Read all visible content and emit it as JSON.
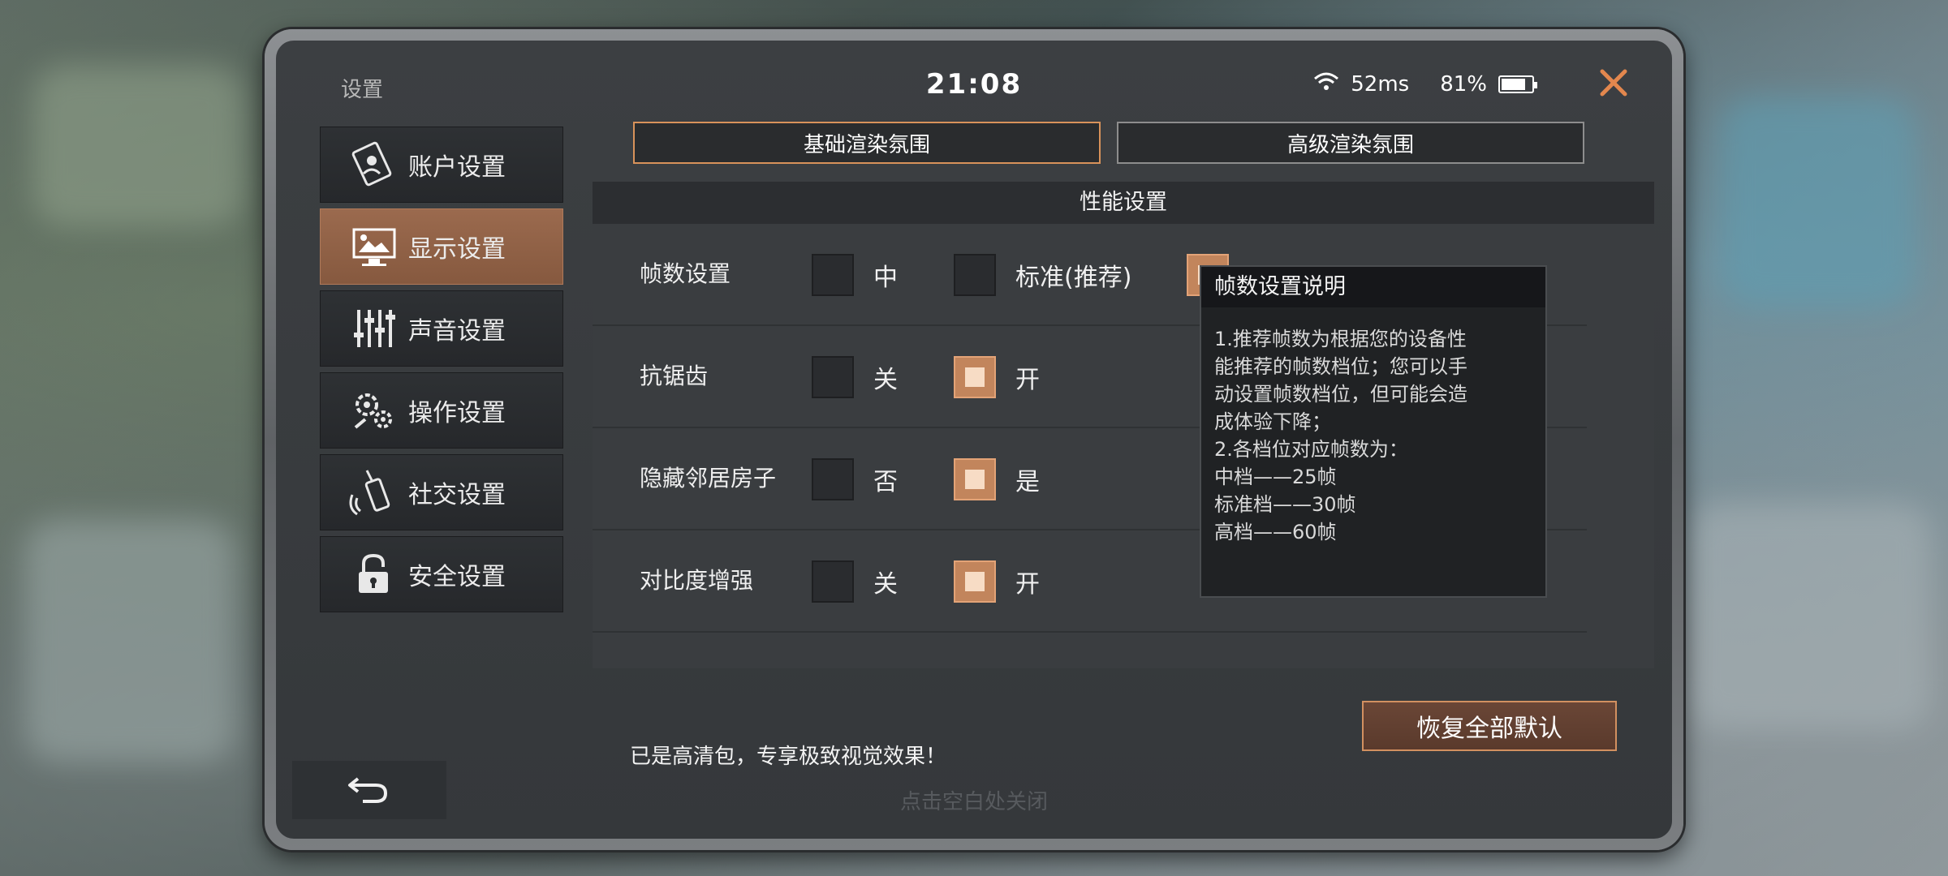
{
  "status": {
    "title": "设置",
    "time": "21:08",
    "ping": "52ms",
    "battery": "81%",
    "battery_level": 0.81
  },
  "sidebar": {
    "items": [
      {
        "label": "账户设置",
        "icon": "account-card-icon"
      },
      {
        "label": "显示设置",
        "icon": "monitor-image-icon"
      },
      {
        "label": "声音设置",
        "icon": "sliders-icon"
      },
      {
        "label": "操作设置",
        "icon": "gears-icon"
      },
      {
        "label": "社交设置",
        "icon": "walkie-talkie-icon"
      },
      {
        "label": "安全设置",
        "icon": "padlock-icon"
      }
    ],
    "active_index": 1
  },
  "tabs": {
    "basic": "基础渲染氛围",
    "advanced": "高级渲染氛围"
  },
  "panel": {
    "header": "性能设置",
    "rows": [
      {
        "label": "帧数设置",
        "options": [
          "中",
          "标准(推荐)",
          ""
        ],
        "selected": 2
      },
      {
        "label": "抗锯齿",
        "options": [
          "关",
          "开"
        ],
        "selected": 1
      },
      {
        "label": "隐藏邻居房子",
        "options": [
          "否",
          "是"
        ],
        "selected": 1
      },
      {
        "label": "对比度增强",
        "options": [
          "关",
          "开"
        ],
        "selected": 1
      }
    ]
  },
  "description": {
    "title": "帧数设置说明",
    "lines": [
      "1.推荐帧数为根据您的设备性",
      "能推荐的帧数档位；您可以手",
      "动设置帧数档位，但可能会造",
      "成体验下降；",
      "2.各档位对应帧数为：",
      "中档——25帧",
      "标准档——30帧",
      "高档——60帧"
    ]
  },
  "footer": {
    "hd_note": "已是高清包，专享极致视觉效果！",
    "reset_label": "恢复全部默认",
    "tap_close": "点击空白处关闭"
  },
  "colors": {
    "accent": "#d8925a",
    "active_tab": "#9b6a4e",
    "close": "#e3874e"
  }
}
